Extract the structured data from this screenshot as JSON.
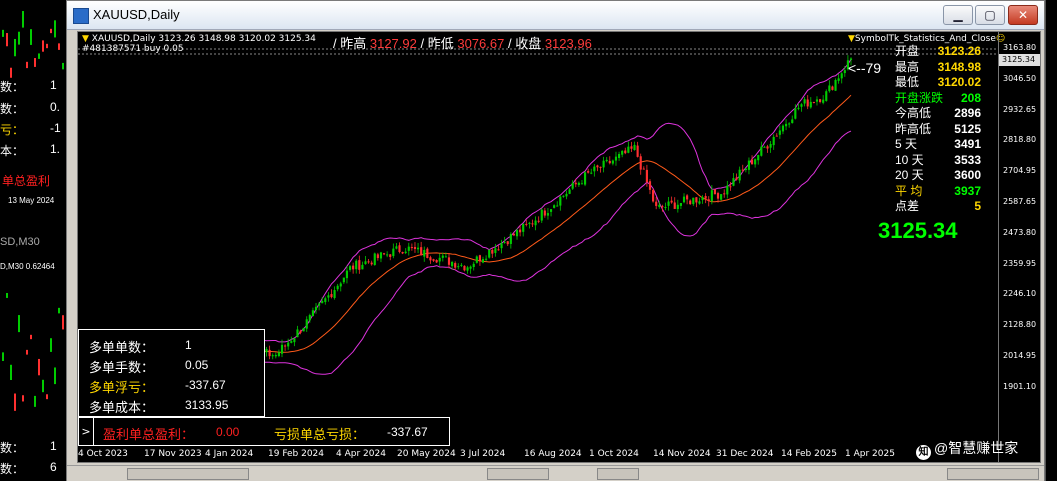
{
  "window": {
    "title": "XAUUSD,Daily"
  },
  "chart_header": {
    "line1": "XAUUSD,Daily  3123.26 3148.98 3120.02 3125.34",
    "line2": "#481387571 buy 0.05",
    "indicator_name": "SymbolTk_Statistics_And_Close"
  },
  "ohlc_bar": {
    "prev_high_label": "/ 昨高",
    "prev_high_value": "3127.92",
    "prev_low_label": "/ 昨低",
    "prev_low_value": "3076.67",
    "close_label": "/ 收盘",
    "close_value": "3123.96"
  },
  "stats": [
    {
      "label": "开盘",
      "value": "3123.26",
      "lc": "#ffffff",
      "vc": "#ffd700"
    },
    {
      "label": "最高",
      "value": "3148.98",
      "lc": "#ffffff",
      "vc": "#ffd700"
    },
    {
      "label": "最低",
      "value": "3120.02",
      "lc": "#ffffff",
      "vc": "#ffd700"
    },
    {
      "label": "开盘涨跌",
      "value": "208",
      "lc": "#00ff00",
      "vc": "#00ff00"
    },
    {
      "label": "今高低",
      "value": "2896",
      "lc": "#ffffff",
      "vc": "#ffffff"
    },
    {
      "label": "昨高低",
      "value": "5125",
      "lc": "#ffffff",
      "vc": "#ffffff"
    },
    {
      "label": "5   天",
      "value": "3491",
      "lc": "#ffffff",
      "vc": "#ffffff"
    },
    {
      "label": "10  天",
      "value": "3533",
      "lc": "#ffffff",
      "vc": "#ffffff"
    },
    {
      "label": "20  天",
      "value": "3600",
      "lc": "#ffffff",
      "vc": "#ffffff"
    },
    {
      "label": "平   均",
      "value": "3937",
      "lc": "#ffd700",
      "vc": "#00ff00"
    },
    {
      "label": "点差",
      "value": "5",
      "lc": "#ffffff",
      "vc": "#ffd700"
    }
  ],
  "big_price": "3125.34",
  "arrow_label": "<--79",
  "y_axis": {
    "ticks": [
      "3163.80",
      "3046.50",
      "2932.65",
      "2818.80",
      "2704.95",
      "2587.65",
      "2473.80",
      "2359.95",
      "2246.10",
      "2128.80",
      "2014.95",
      "1901.10"
    ],
    "current_price": "3125.34"
  },
  "x_axis": {
    "ticks": [
      "4 Oct 2023",
      "17 Nov 2023",
      "4 Jan 2024",
      "19 Feb 2024",
      "4 Apr 2024",
      "20 May 2024",
      "3 Jul 2024",
      "16 Aug 2024",
      "1 Oct 2024",
      "14 Nov 2024",
      "31 Dec 2024",
      "14 Feb 2025",
      "1 Apr 2025"
    ]
  },
  "long_positions": {
    "rows": [
      {
        "label": "多单单数：",
        "value": "1",
        "color": "#ffffff"
      },
      {
        "label": "多单手数：",
        "value": "0.05",
        "color": "#ffffff"
      },
      {
        "label": "多单浮亏：",
        "value": "-337.67",
        "color": "#ffd700"
      },
      {
        "label": "多单成本：",
        "value": "3133.95",
        "color": "#ffffff"
      }
    ]
  },
  "pnl_bar": {
    "toggle": ">",
    "profit_label": "盈利单总盈利：",
    "profit_value": "0.00",
    "loss_label": "亏损单总亏损：",
    "loss_value": "-337.67"
  },
  "watermark": "@智慧赚世家",
  "background_left": {
    "items": [
      "数：",
      "1",
      "数：",
      "0.",
      "亏：",
      "-1",
      "本：",
      "1.",
      "单总盈利",
      "13 May 2024",
      "SD,M30",
      "D,M30  0.62464",
      "数：",
      "1",
      "数：",
      "6"
    ]
  },
  "chart_data": {
    "type": "candlestick",
    "symbol": "XAUUSD",
    "timeframe": "Daily",
    "last_bar": {
      "open": 3123.26,
      "high": 3148.98,
      "low": 3120.02,
      "close": 3125.34
    },
    "ylim": [
      1850,
      3200
    ],
    "approx_close_path": [
      {
        "date": "2023-10-04",
        "close": 1820
      },
      {
        "date": "2023-11-17",
        "close": 1980
      },
      {
        "date": "2024-01-04",
        "close": 2045
      },
      {
        "date": "2024-02-19",
        "close": 2020
      },
      {
        "date": "2024-03-15",
        "close": 2160
      },
      {
        "date": "2024-04-12",
        "close": 2345
      },
      {
        "date": "2024-05-20",
        "close": 2420
      },
      {
        "date": "2024-07-03",
        "close": 2350
      },
      {
        "date": "2024-08-16",
        "close": 2505
      },
      {
        "date": "2024-09-26",
        "close": 2690
      },
      {
        "date": "2024-10-30",
        "close": 2790
      },
      {
        "date": "2024-11-14",
        "close": 2565
      },
      {
        "date": "2024-12-31",
        "close": 2625
      },
      {
        "date": "2025-01-31",
        "close": 2800
      },
      {
        "date": "2025-02-24",
        "close": 2950
      },
      {
        "date": "2025-03-14",
        "close": 2990
      },
      {
        "date": "2025-04-01",
        "close": 3125
      }
    ],
    "indicators": [
      "Bollinger Bands",
      "Moving Average"
    ]
  }
}
